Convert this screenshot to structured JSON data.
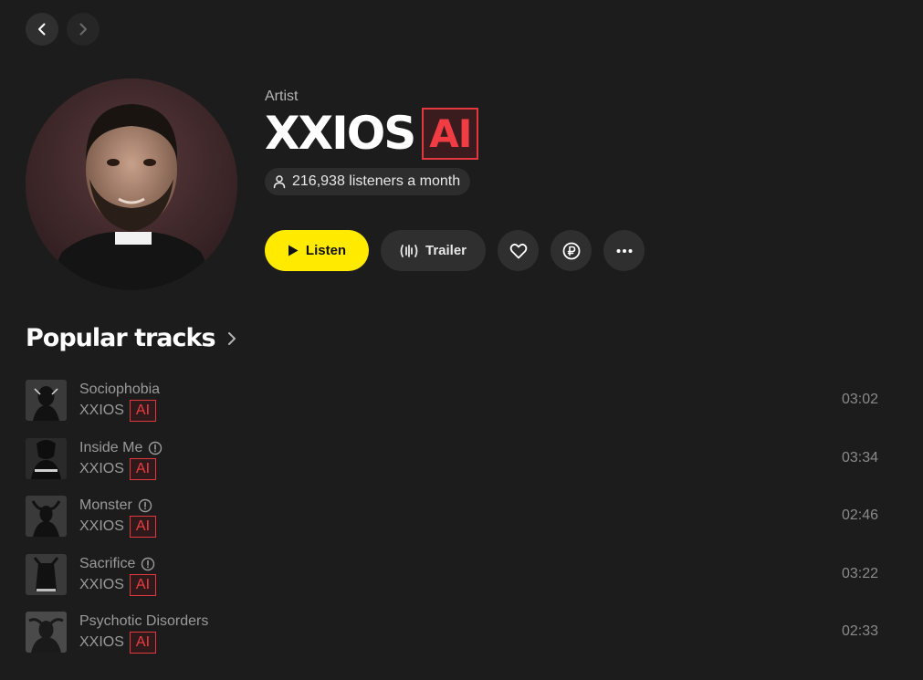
{
  "nav": {
    "back_icon": "chevron-left-icon",
    "forward_icon": "chevron-right-icon"
  },
  "artist": {
    "label": "Artist",
    "name": "XXIOS",
    "ai_badge": "AI",
    "listeners": "216,938 listeners a month"
  },
  "actions": {
    "listen_label": "Listen",
    "trailer_label": "Trailer",
    "like_icon": "heart-icon",
    "donate_icon": "ruble-icon",
    "more_icon": "more-icon"
  },
  "popular": {
    "title": "Popular tracks",
    "tracks": [
      {
        "title": "Sociophobia",
        "artist": "XXIOS",
        "badge": "AI",
        "duration": "03:02",
        "info": false
      },
      {
        "title": "Inside Me",
        "artist": "XXIOS",
        "badge": "AI",
        "duration": "03:34",
        "info": true
      },
      {
        "title": "Monster",
        "artist": "XXIOS",
        "badge": "AI",
        "duration": "02:46",
        "info": true
      },
      {
        "title": "Sacrifice",
        "artist": "XXIOS",
        "badge": "AI",
        "duration": "03:22",
        "info": true
      },
      {
        "title": "Psychotic Disorders",
        "artist": "XXIOS",
        "badge": "AI",
        "duration": "02:33",
        "info": false
      }
    ]
  },
  "colors": {
    "background": "#1c1c1c",
    "accent_yellow": "#ffea00",
    "ai_red": "#e0383e"
  }
}
